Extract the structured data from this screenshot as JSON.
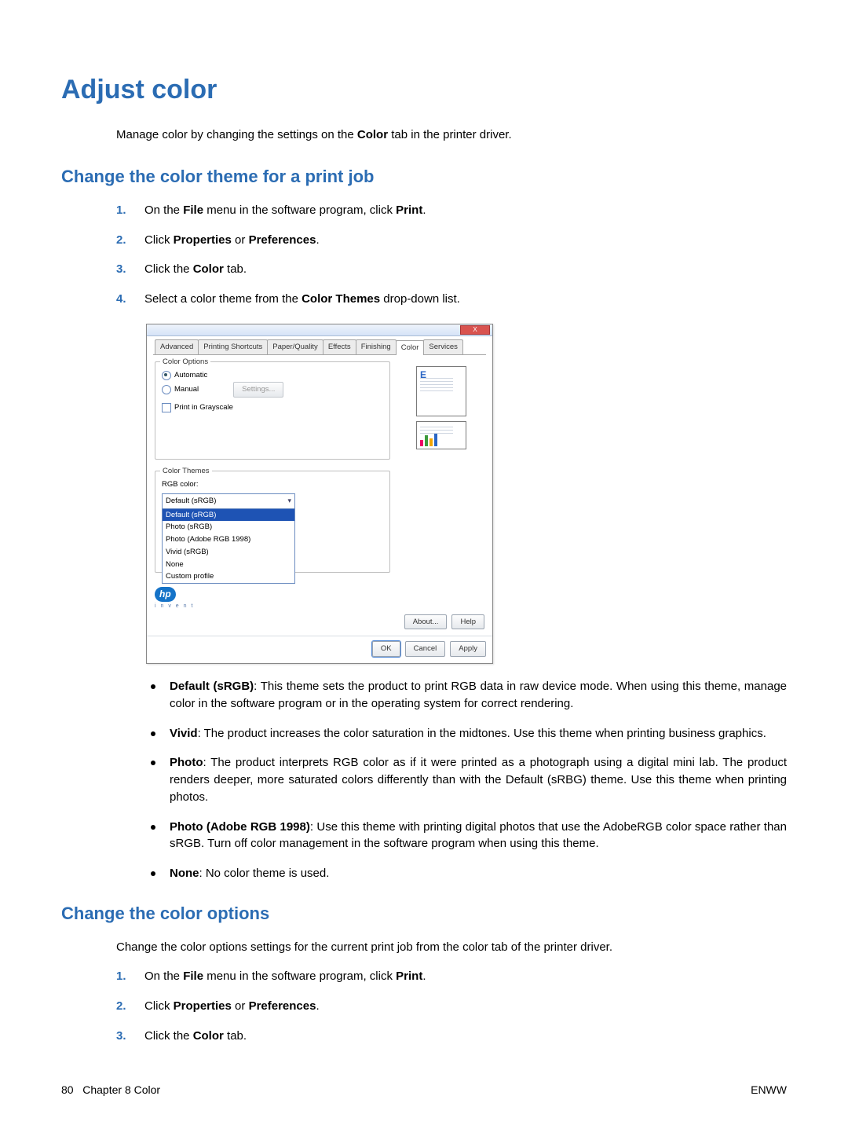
{
  "title": "Adjust color",
  "intro_pre": "Manage color by changing the settings on the ",
  "intro_bold": "Color",
  "intro_post": " tab in the printer driver.",
  "section1": "Change the color theme for a print job",
  "steps1": {
    "s1_pre": "On the ",
    "s1_b1": "File",
    "s1_mid": " menu in the software program, click ",
    "s1_b2": "Print",
    "s1_post": ".",
    "s2_pre": "Click ",
    "s2_b1": "Properties",
    "s2_mid": " or ",
    "s2_b2": "Preferences",
    "s2_post": ".",
    "s3_pre": "Click the ",
    "s3_b": "Color",
    "s3_post": " tab.",
    "s4_pre": "Select a color theme from the ",
    "s4_b": "Color Themes",
    "s4_post": " drop-down list."
  },
  "dialog": {
    "close": "X",
    "tabs": {
      "advanced": "Advanced",
      "shortcuts": "Printing Shortcuts",
      "paper": "Paper/Quality",
      "effects": "Effects",
      "finishing": "Finishing",
      "color": "Color",
      "services": "Services"
    },
    "color_options_legend": "Color Options",
    "automatic": "Automatic",
    "manual": "Manual",
    "settings_btn": "Settings...",
    "grayscale": "Print in Grayscale",
    "themes_legend": "Color Themes",
    "rgb_label": "RGB color:",
    "dropdown_head": "Default (sRGB)",
    "opts": {
      "o0": "Default (sRGB)",
      "o1": "Photo (sRGB)",
      "o2": "Photo (Adobe RGB 1998)",
      "o3": "Vivid (sRGB)",
      "o4": "None",
      "o5": "Custom profile"
    },
    "about": "About...",
    "help": "Help",
    "ok": "OK",
    "cancel": "Cancel",
    "apply": "Apply",
    "hp": "hp",
    "invent": "i n v e n t",
    "E": "E"
  },
  "bullets1": {
    "b1_b": "Default (sRGB)",
    "b1_t": ": This theme sets the product to print RGB data in raw device mode. When using this theme, manage color in the software program or in the operating system for correct rendering.",
    "b2_b": "Vivid",
    "b2_t": ": The product increases the color saturation in the midtones. Use this theme when printing business graphics.",
    "b3_b": "Photo",
    "b3_t": ": The product interprets RGB color as if it were printed as a photograph using a digital mini lab. The product renders deeper, more saturated colors differently than with the Default (sRBG) theme. Use this theme when printing photos.",
    "b4_b": "Photo (Adobe RGB 1998)",
    "b4_t": ": Use this theme with printing digital photos that use the AdobeRGB color space rather than sRGB. Turn off color management in the software program when using this theme.",
    "b5_b": "None",
    "b5_t": ": No color theme is used."
  },
  "section2": "Change the color options",
  "para2": "Change the color options settings for the current print job from the color tab of the printer driver.",
  "steps2": {
    "s1_pre": "On the ",
    "s1_b1": "File",
    "s1_mid": " menu in the software program, click ",
    "s1_b2": "Print",
    "s1_post": ".",
    "s2_pre": "Click ",
    "s2_b1": "Properties",
    "s2_mid": " or ",
    "s2_b2": "Preferences",
    "s2_post": ".",
    "s3_pre": "Click the ",
    "s3_b": "Color",
    "s3_post": " tab."
  },
  "footer": {
    "page_no": "80",
    "chapter": "Chapter 8   Color",
    "brand": "ENWW"
  }
}
